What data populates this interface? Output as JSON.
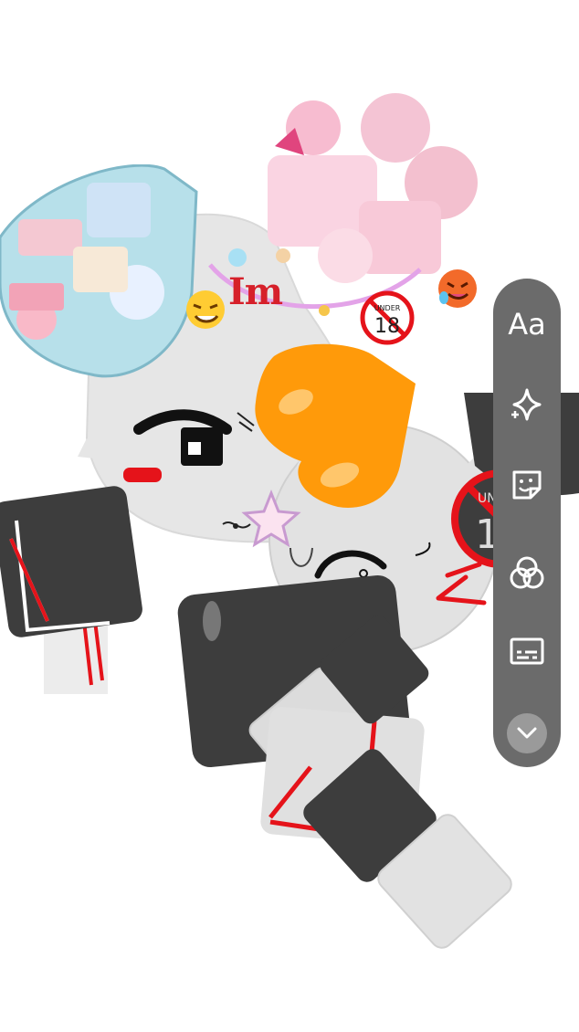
{
  "canvas": {
    "text_sticker": "Im",
    "badge_text": "UNDER",
    "badge_number": "18"
  },
  "tools": {
    "text_label": "Aa",
    "items": [
      {
        "name": "text-tool",
        "icon": "text-aa-icon"
      },
      {
        "name": "effects-tool",
        "icon": "sparkle-icon"
      },
      {
        "name": "sticker-tool",
        "icon": "sticker-icon"
      },
      {
        "name": "filter-tool",
        "icon": "overlap-circles-icon"
      },
      {
        "name": "captions-tool",
        "icon": "captions-icon"
      },
      {
        "name": "more-tools",
        "icon": "chevron-down-icon"
      }
    ]
  },
  "colors": {
    "rail": "#6b6b6b",
    "heart": "#ff9a0a",
    "dark_square": "#3d3d3d",
    "red_accent": "#e5131a"
  }
}
